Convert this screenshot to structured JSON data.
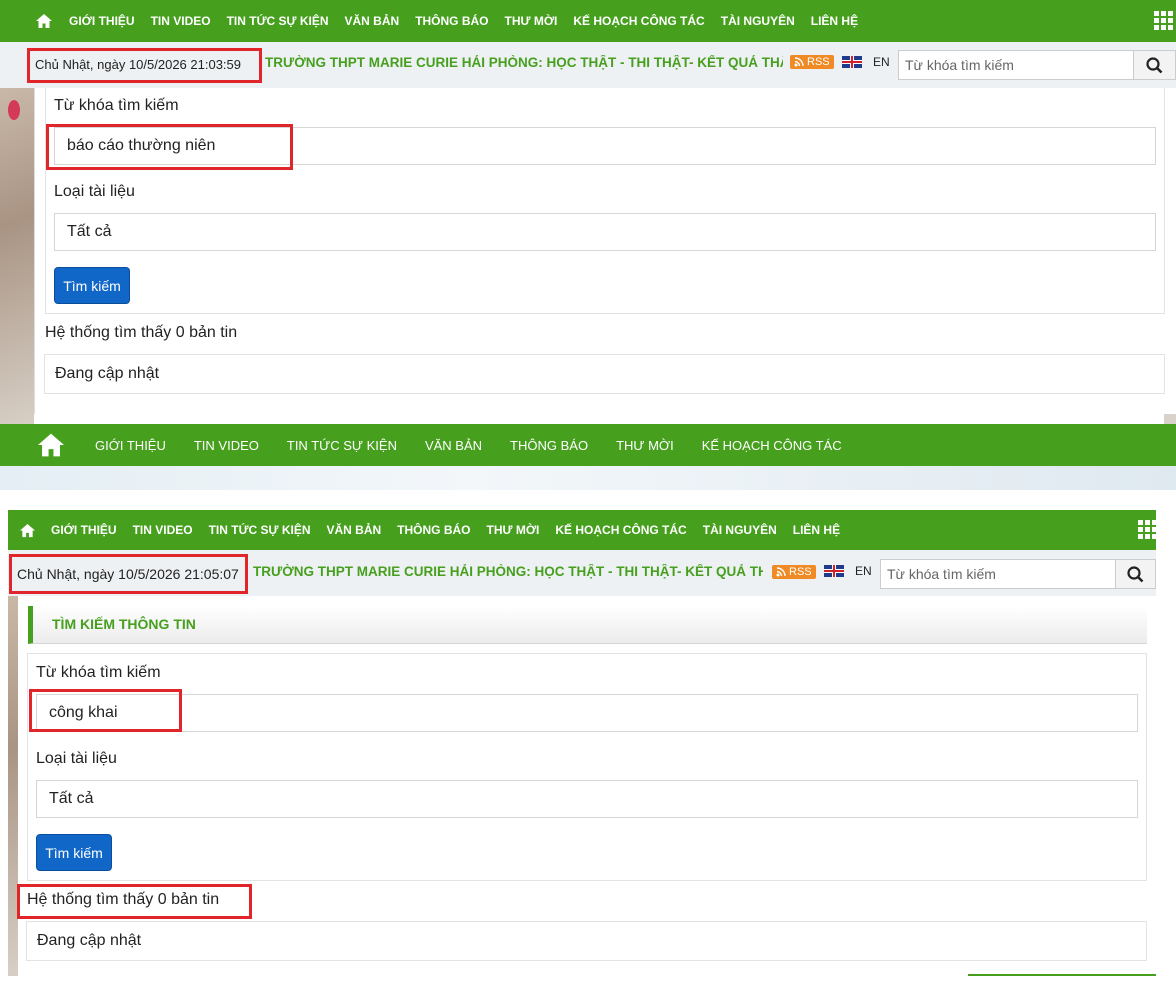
{
  "top": {
    "nav": [
      "GIỚI THIỆU",
      "TIN VIDEO",
      "TIN TỨC SỰ KIỆN",
      "VĂN BẢN",
      "THÔNG BÁO",
      "THƯ MỜI",
      "KẾ HOẠCH CÔNG TÁC",
      "TÀI NGUYÊN",
      "LIÊN HỆ"
    ],
    "date": "Chủ Nhật, ngày 10/5/2026 21:03:59",
    "ticker": "TRƯỜNG THPT MARIE CURIE HẢI PHÒNG: HỌC THẬT - THI THẬT- KẾT QUẢ THẬT",
    "rss": "RSS",
    "lang": "EN",
    "search_placeholder": "Từ khóa tìm kiếm",
    "form": {
      "keyword_label": "Từ khóa tìm kiếm",
      "keyword_value": "báo cáo thường niên",
      "type_label": "Loại tài liệu",
      "type_value": "Tất cả",
      "button": "Tìm kiếm",
      "result": "Hệ thống tìm thấy 0 bản tin",
      "updating": "Đang cập nhật"
    },
    "footer_nav": [
      "GIỚI THIỆU",
      "TIN VIDEO",
      "TIN TỨC SỰ KIỆN",
      "VĂN BẢN",
      "THÔNG BÁO",
      "THƯ MỜI",
      "KẾ HOẠCH CÔNG TÁC"
    ]
  },
  "bottom": {
    "nav": [
      "GIỚI THIỆU",
      "TIN VIDEO",
      "TIN TỨC SỰ KIỆN",
      "VĂN BẢN",
      "THÔNG BÁO",
      "THƯ MỜI",
      "KẾ HOẠCH CÔNG TÁC",
      "TÀI NGUYÊN",
      "LIÊN HỆ"
    ],
    "date": "Chủ Nhật, ngày 10/5/2026 21:05:07",
    "ticker": "TRƯỜNG THPT MARIE CURIE HẢI PHÒNG: HỌC THẬT - THI THẬT- KẾT QUẢ THẬ",
    "rss": "RSS",
    "lang": "EN",
    "search_placeholder": "Từ khóa tìm kiếm",
    "section_title": "TÌM KIẾM THÔNG TIN",
    "form": {
      "keyword_label": "Từ khóa tìm kiếm",
      "keyword_value": "công khai",
      "type_label": "Loại tài liệu",
      "type_value": "Tất cả",
      "button": "Tìm kiếm",
      "result": "Hệ thống tìm thấy 0 bản tin",
      "updating": "Đang cập nhật"
    }
  },
  "colors": {
    "brand_green": "#46a01e",
    "button_blue": "#1167c7",
    "highlight_red": "#e0262b",
    "rss_orange": "#f08a24"
  }
}
